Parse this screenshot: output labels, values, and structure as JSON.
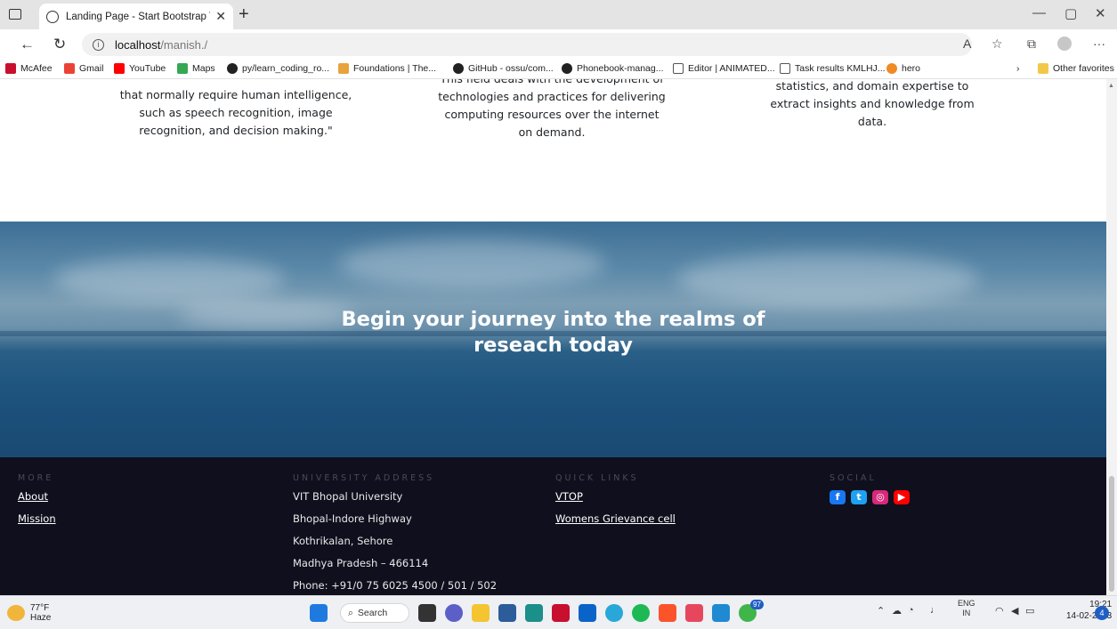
{
  "browser": {
    "tab_title": "Landing Page - Start Bootstrap Th",
    "url_host": "localhost",
    "url_path": "/manish./",
    "bookmarks": [
      {
        "label": "McAfee",
        "color": "#c8102e"
      },
      {
        "label": "Gmail",
        "color": "#ea4335"
      },
      {
        "label": "YouTube",
        "color": "#ff0000"
      },
      {
        "label": "Maps",
        "color": "#34a853"
      },
      {
        "label": "py/learn_coding_ro...",
        "color": "#222222"
      },
      {
        "label": "Foundations | The...",
        "color": "#e8a33d"
      },
      {
        "label": "GitHub - ossu/com...",
        "color": "#222222"
      },
      {
        "label": "Phonebook-manag...",
        "color": "#222222"
      },
      {
        "label": "Editor | ANIMATED...",
        "color": "#555555"
      },
      {
        "label": "Task results KMLHJ...",
        "color": "#555555"
      },
      {
        "label": "hero",
        "color": "#f08a24"
      }
    ],
    "other_favorites": "Other favorites"
  },
  "features": {
    "col1": [
      "that normally require human intelligence,",
      "such as speech recognition, image",
      "recognition, and decision making.\""
    ],
    "col2": [
      "This field deals with the development of",
      "technologies and practices for delivering",
      "computing resources over the internet",
      "on demand."
    ],
    "col3": [
      "statistics, and domain expertise to",
      "extract insights and knowledge from",
      "data."
    ]
  },
  "cta": {
    "line1": "Begin your journey into the realms of",
    "line2": "reseach today"
  },
  "footer": {
    "more": {
      "heading": "MORE",
      "links": [
        "About",
        "Mission"
      ]
    },
    "address": {
      "heading": "UNIVERSITY ADDRESS",
      "lines": [
        "VIT Bhopal University",
        "Bhopal-Indore Highway",
        "Kothrikalan, Sehore",
        "Madhya Pradesh – 466114",
        "Phone: +91/0 75 6025 4500 / 501 / 502"
      ]
    },
    "quick_links": {
      "heading": "QUICK LINKS",
      "links": [
        "VTOP",
        "Womens Grievance cell"
      ]
    },
    "social": {
      "heading": "SOCIAL",
      "icons": [
        "facebook-icon",
        "twitter-icon",
        "instagram-icon",
        "youtube-icon"
      ]
    }
  },
  "taskbar": {
    "temperature": "77°F",
    "weather": "Haze",
    "search_label": "Search",
    "lang1": "ENG",
    "lang2": "IN",
    "time": "19:21",
    "date": "14-02-2023",
    "badge": "97",
    "notifications": "4"
  }
}
